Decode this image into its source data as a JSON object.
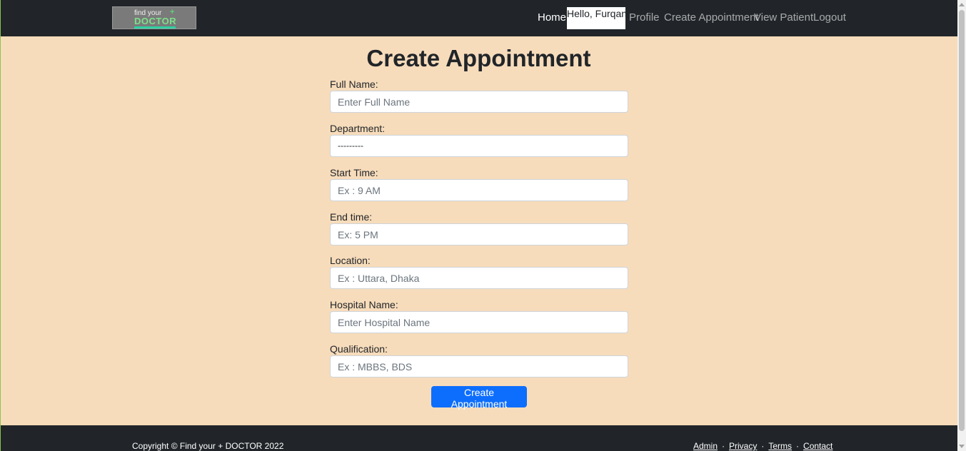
{
  "navbar": {
    "logo": {
      "line1": "find your",
      "line2": "DOCTOR"
    },
    "links": {
      "home": "Home",
      "greeting": "Hello, Furqann",
      "profile": "Profile",
      "create_appointment": "Create Appointment",
      "view_patient": "View Patient",
      "logout": "Logout"
    }
  },
  "form": {
    "title": "Create Appointment",
    "fields": {
      "full_name": {
        "label": "Full Name:",
        "placeholder": "Enter Full Name"
      },
      "department": {
        "label": "Department:",
        "value": "---------"
      },
      "start_time": {
        "label": "Start Time:",
        "placeholder": "Ex : 9 AM"
      },
      "end_time": {
        "label": "End time:",
        "placeholder": "Ex: 5 PM"
      },
      "location": {
        "label": "Location:",
        "placeholder": "Ex : Uttara, Dhaka"
      },
      "hospital_name": {
        "label": "Hospital Name:",
        "placeholder": "Enter Hospital Name"
      },
      "qualification": {
        "label": "Qualification:",
        "placeholder": "Ex : MBBS, BDS"
      }
    },
    "submit_label": "Create Appointment"
  },
  "footer": {
    "copyright": "Copyright © Find your + DOCTOR 2022",
    "links": {
      "admin": "Admin",
      "privacy": "Privacy",
      "terms": "Terms",
      "contact": "Contact"
    },
    "separator": "·"
  },
  "colors": {
    "page_background": "#f7dcbb",
    "navbar_background": "#212529",
    "primary_button": "#0d6efd"
  }
}
